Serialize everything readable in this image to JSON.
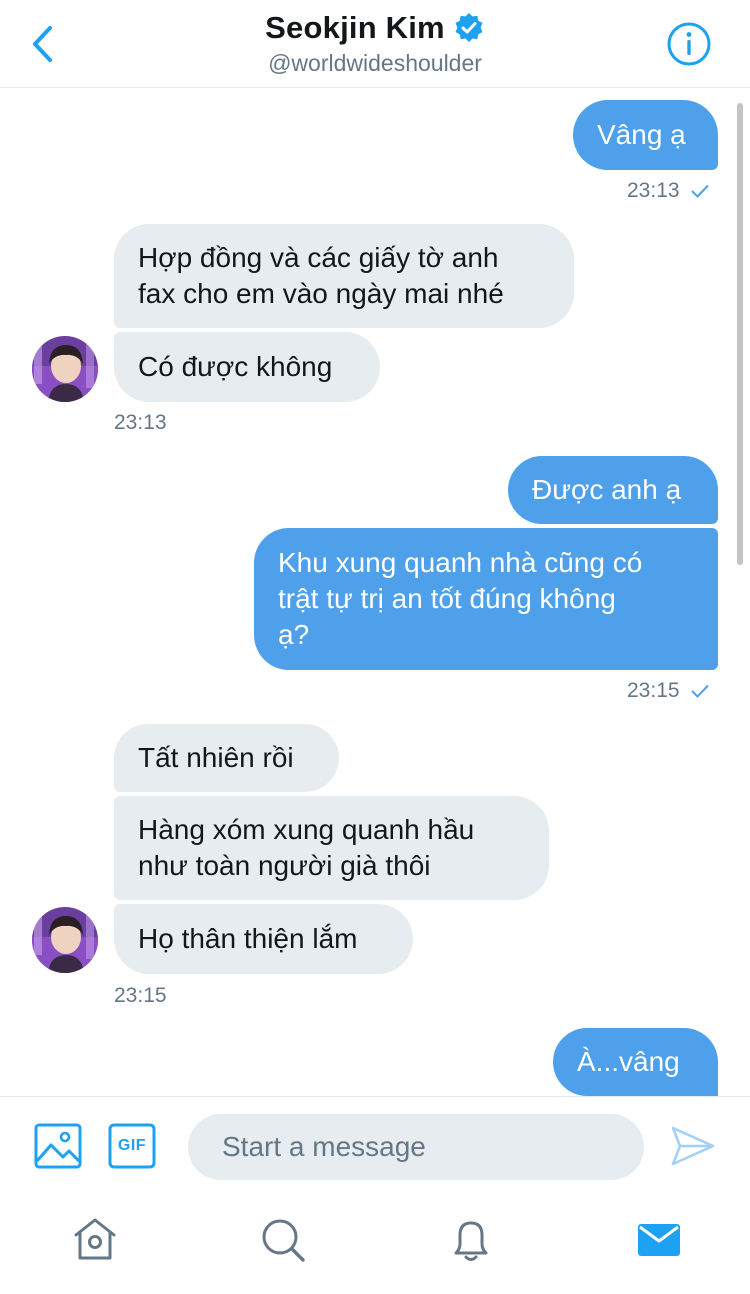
{
  "header": {
    "title": "Seokjin Kim",
    "handle": "@worldwideshoulder",
    "verified": true
  },
  "colors": {
    "accent": "#1da1f2",
    "outgoing_bubble": "#4ea0ea",
    "incoming_bubble": "#e6ecf0",
    "muted_text": "#657786"
  },
  "messages": [
    {
      "direction": "outgoing",
      "text": "Vâng ạ"
    },
    {
      "direction": "outgoing",
      "time": "23:13",
      "read": true
    },
    {
      "direction": "incoming",
      "text": "Hợp đồng và các giấy tờ anh\nfax cho em vào ngày mai nhé"
    },
    {
      "direction": "incoming",
      "text": "Có được không"
    },
    {
      "direction": "incoming",
      "time": "23:13"
    },
    {
      "direction": "outgoing",
      "text": "Được anh ạ"
    },
    {
      "direction": "outgoing",
      "text": "Khu xung quanh nhà cũng có\ntrật tự trị an tốt đúng không\nạ?"
    },
    {
      "direction": "outgoing",
      "time": "23:15",
      "read": true
    },
    {
      "direction": "incoming",
      "text": "Tất nhiên rồi"
    },
    {
      "direction": "incoming",
      "text": "Hàng xóm xung quanh hầu\nnhư toàn người già thôi"
    },
    {
      "direction": "incoming",
      "text": "Họ thân thiện lắm"
    },
    {
      "direction": "incoming",
      "time": "23:15"
    },
    {
      "direction": "outgoing",
      "text": "À...vâng"
    }
  ],
  "composer": {
    "placeholder": "Start a message",
    "media_icon": "image-icon",
    "gif_label": "GIF",
    "send_icon": "send-icon"
  },
  "tabbar": {
    "items": [
      "home-icon",
      "search-icon",
      "notifications-icon",
      "messages-icon"
    ],
    "active": "messages-icon"
  }
}
